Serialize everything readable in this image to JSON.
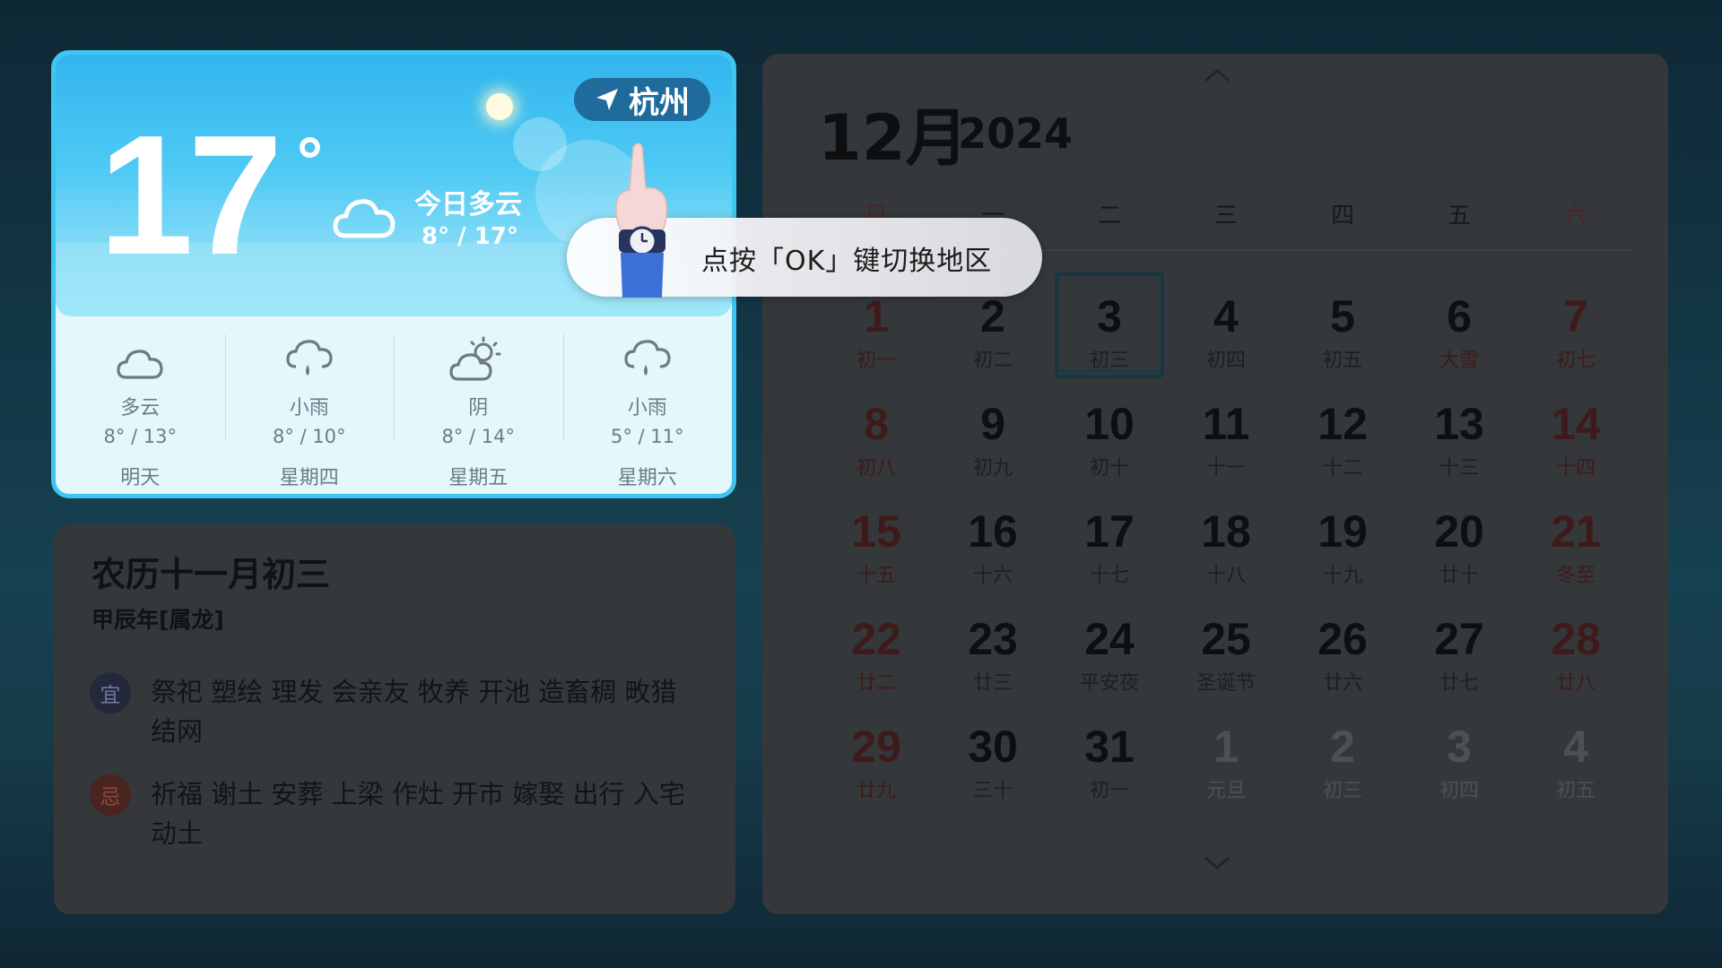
{
  "weather": {
    "city": "杭州",
    "temperature": "17",
    "temperature_unit": "°",
    "today_desc": "今日多云",
    "today_range": "8° / 17°",
    "forecast": [
      {
        "icon": "cloud-icon",
        "condition": "多云",
        "range": "8° / 13°",
        "day": "明天"
      },
      {
        "icon": "light-rain-icon",
        "condition": "小雨",
        "range": "8° / 10°",
        "day": "星期四"
      },
      {
        "icon": "partly-sunny-icon",
        "condition": "阴",
        "range": "8° / 14°",
        "day": "星期五"
      },
      {
        "icon": "light-rain-icon",
        "condition": "小雨",
        "range": "5° / 11°",
        "day": "星期六"
      }
    ]
  },
  "tooltip": {
    "text": "点按「OK」键切换地区"
  },
  "lunar": {
    "title": "农历十一月初三",
    "year": "甲辰年[属龙]",
    "yi_label": "宜",
    "yi_text": "祭祀 塑绘 理发 会亲友 牧养 开池 造畜稠 畋猎 结网",
    "ji_label": "忌",
    "ji_text": "祈福 谢土 安葬 上梁 作灶 开市 嫁娶 出行 入宅 动土"
  },
  "calendar": {
    "month": "12月",
    "year": "2024",
    "weekdays": [
      "日",
      "一",
      "二",
      "三",
      "四",
      "五",
      "六"
    ],
    "weeks": [
      [
        {
          "d": "1",
          "l": "初一"
        },
        {
          "d": "2",
          "l": "初二"
        },
        {
          "d": "3",
          "l": "初三"
        },
        {
          "d": "4",
          "l": "初四"
        },
        {
          "d": "5",
          "l": "初五"
        },
        {
          "d": "6",
          "l": "大雪"
        },
        {
          "d": "7",
          "l": "初七"
        }
      ],
      [
        {
          "d": "8",
          "l": "初八"
        },
        {
          "d": "9",
          "l": "初九"
        },
        {
          "d": "10",
          "l": "初十"
        },
        {
          "d": "11",
          "l": "十一"
        },
        {
          "d": "12",
          "l": "十二"
        },
        {
          "d": "13",
          "l": "十三"
        },
        {
          "d": "14",
          "l": "十四"
        }
      ],
      [
        {
          "d": "15",
          "l": "十五"
        },
        {
          "d": "16",
          "l": "十六"
        },
        {
          "d": "17",
          "l": "十七"
        },
        {
          "d": "18",
          "l": "十八"
        },
        {
          "d": "19",
          "l": "十九"
        },
        {
          "d": "20",
          "l": "廿十"
        },
        {
          "d": "21",
          "l": "冬至"
        }
      ],
      [
        {
          "d": "22",
          "l": "廿二"
        },
        {
          "d": "23",
          "l": "廿三"
        },
        {
          "d": "24",
          "l": "平安夜"
        },
        {
          "d": "25",
          "l": "圣诞节"
        },
        {
          "d": "26",
          "l": "廿六"
        },
        {
          "d": "27",
          "l": "廿七"
        },
        {
          "d": "28",
          "l": "廿八"
        }
      ],
      [
        {
          "d": "29",
          "l": "廿九"
        },
        {
          "d": "30",
          "l": "三十"
        },
        {
          "d": "31",
          "l": "初一"
        },
        {
          "d": "1",
          "l": "元旦"
        },
        {
          "d": "2",
          "l": "初三"
        },
        {
          "d": "3",
          "l": "初四"
        },
        {
          "d": "4",
          "l": "初五"
        }
      ]
    ],
    "today_index": [
      0,
      2
    ],
    "festival_cells": [
      [
        0,
        5
      ],
      [
        2,
        6
      ]
    ],
    "dim_from": [
      4,
      3
    ]
  }
}
